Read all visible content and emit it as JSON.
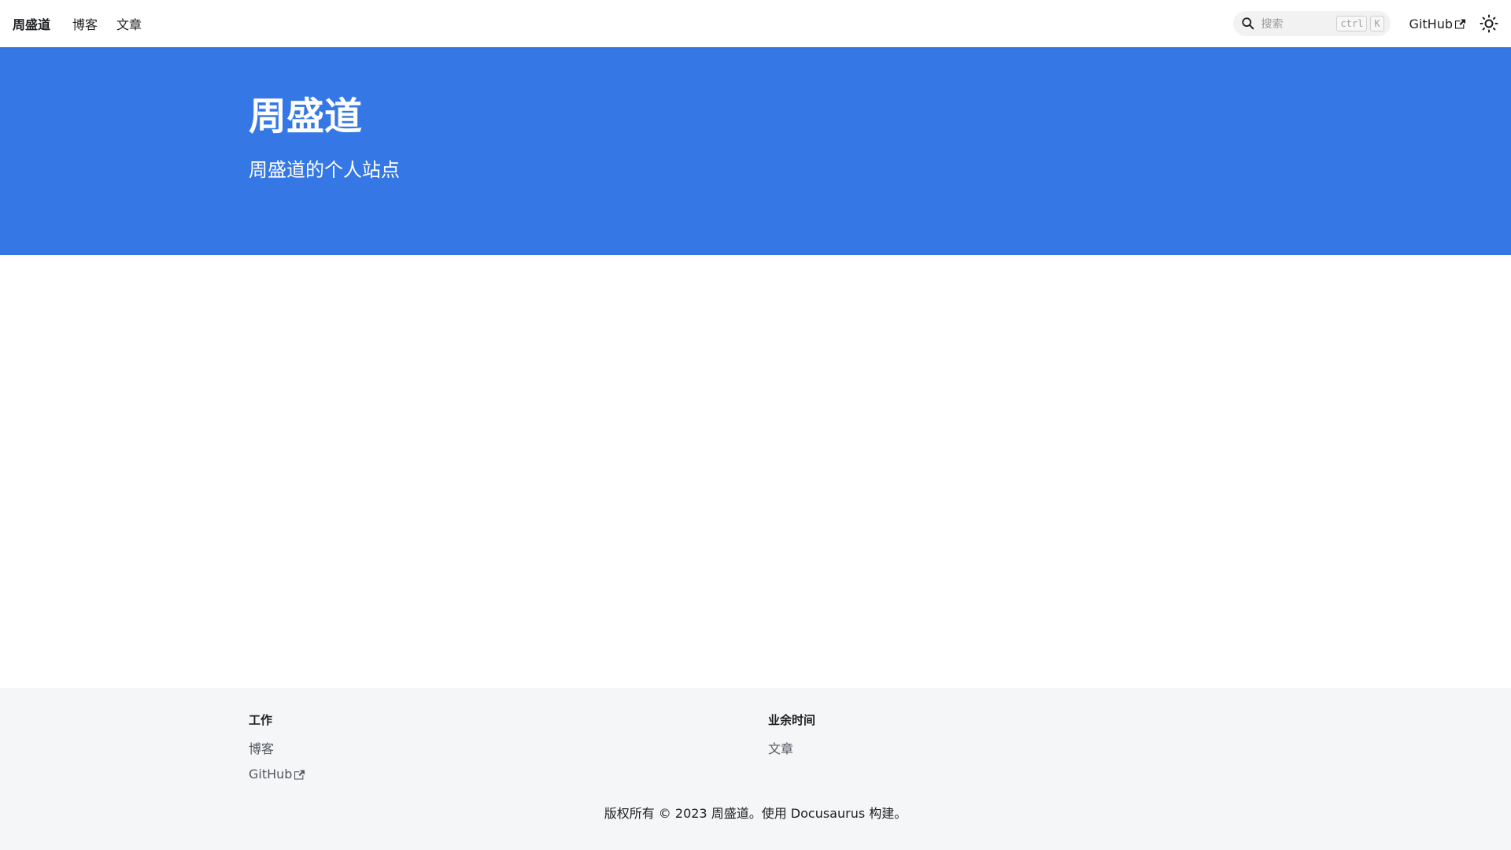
{
  "navbar": {
    "brand": "周盛道",
    "links": [
      {
        "label": "博客"
      },
      {
        "label": "文章"
      }
    ],
    "search": {
      "placeholder": "搜索",
      "kbd_ctrl": "ctrl",
      "kbd_key": "K"
    },
    "github_label": "GitHub",
    "theme_icon": "sun-icon"
  },
  "hero": {
    "title": "周盛道",
    "subtitle": "周盛道的个人站点",
    "background_color": "#3578e5"
  },
  "footer": {
    "columns": [
      {
        "title": "工作",
        "links": [
          {
            "label": "博客"
          },
          {
            "label": "GitHub",
            "external": true
          }
        ]
      },
      {
        "title": "业余时间",
        "links": [
          {
            "label": "文章"
          }
        ]
      }
    ],
    "copyright": "版权所有 © 2023 周盛道。使用 Docusaurus 构建。"
  }
}
